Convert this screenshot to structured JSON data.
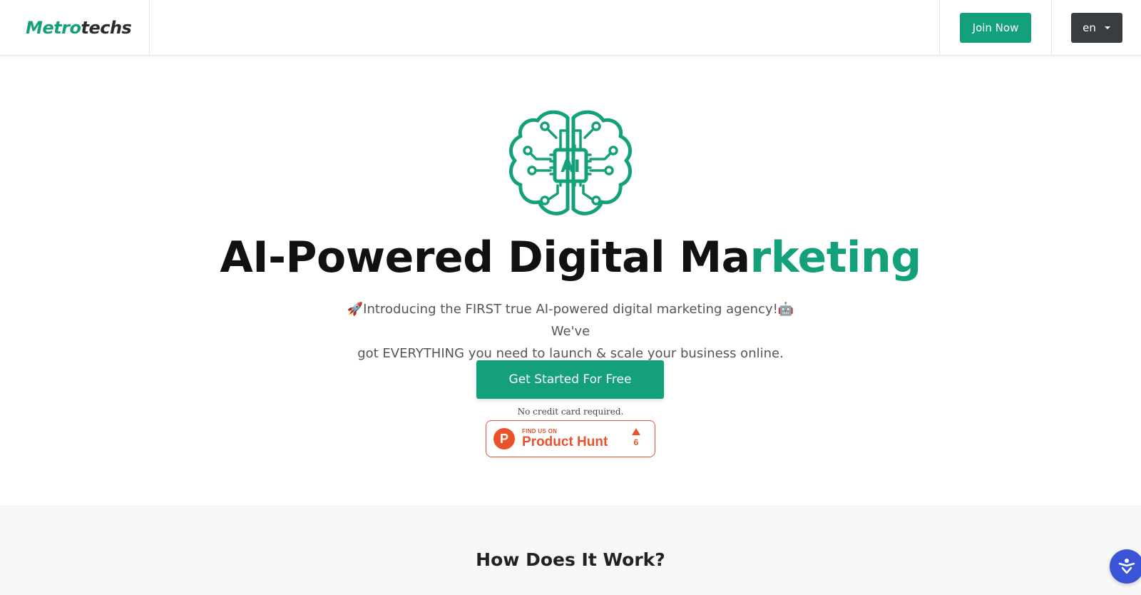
{
  "header": {
    "logo_part1": "Metro",
    "logo_part2": "techs",
    "join_label": "Join Now",
    "lang_label": "en"
  },
  "hero": {
    "icon_name": "ai-brain-icon",
    "icon_text": "AI",
    "headline_main": "AI-Powered Digital Ma",
    "headline_accent": "rketing",
    "subtitle_line1": "🚀Introducing the FIRST true AI-powered digital marketing agency!🤖 We've",
    "subtitle_line2": "got EVERYTHING you need to launch & scale your business online.",
    "cta_label": "Get Started For Free",
    "no_credit_card": "No credit card required."
  },
  "product_hunt": {
    "small_text": "FIND US ON",
    "big_text": "Product Hunt",
    "logo_letter": "P",
    "upvotes": "6"
  },
  "how_section": {
    "title": "How Does It Work?"
  },
  "accessibility": {
    "icon_name": "accessibility-icon"
  },
  "colors": {
    "brand_green": "#13a07a",
    "dark_button": "#3a3d40",
    "product_hunt_orange": "#ea532a",
    "accessibility_blue": "#3954d6"
  }
}
